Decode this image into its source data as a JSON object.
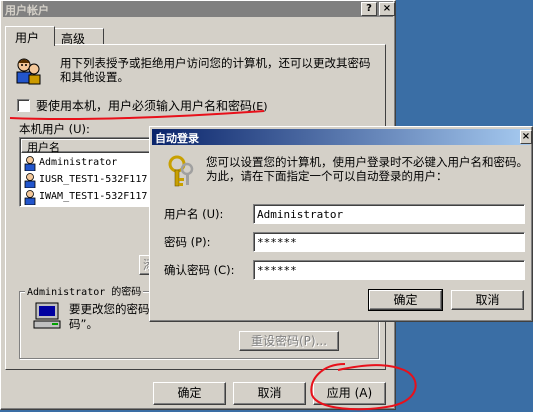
{
  "main_window": {
    "title": "用户帐户",
    "help_button": "?",
    "close_button": "×",
    "tabs": [
      {
        "label": "用户"
      },
      {
        "label": "高级"
      }
    ],
    "intro_text": "用下列表授予或拒绝用户访问您的计算机，还可以更改其密码和其他设置。",
    "must_login_checkbox": {
      "label": "要使用本机，用户必须输入用户名和密码",
      "accelerator": "(E)",
      "checked": false
    },
    "users_label": "本机用户 (U):",
    "list_header": "用户名",
    "users": [
      {
        "name": "Administrator"
      },
      {
        "name": "IUSR_TEST1-532F117"
      },
      {
        "name": "IWAM_TEST1-532F117"
      }
    ],
    "partial_button": "添",
    "password_group_title": "Administrator 的密码",
    "password_text": "要更改您的密码",
    "password_text2": "码”。",
    "reset_password_button": "重设密码(P)...",
    "ok_button": "确定",
    "cancel_button": "取消",
    "apply_button": "应用 (A)"
  },
  "dialog": {
    "title": "自动登录",
    "close_button": "×",
    "description": "您可以设置您的计算机，使用户登录时不必键入用户名和密码。为此，请在下面指定一个可以自动登录的用户：",
    "username_label": "用户名 (U):",
    "username_value": "Administrator",
    "password_label": "密码 (P):",
    "password_value": "******",
    "confirm_label": "确认密码 (C):",
    "confirm_value": "******",
    "ok_button": "确定",
    "cancel_button": "取消"
  },
  "colors": {
    "desktop": "#3a6ea5",
    "face": "#d4d0c8",
    "active_title_start": "#0a246a",
    "active_title_end": "#a6caf0",
    "annotation_red": "#e8101a"
  },
  "icons": [
    "users-icon",
    "user-icon",
    "keys-icon",
    "computer-icon",
    "checkbox-icon"
  ]
}
